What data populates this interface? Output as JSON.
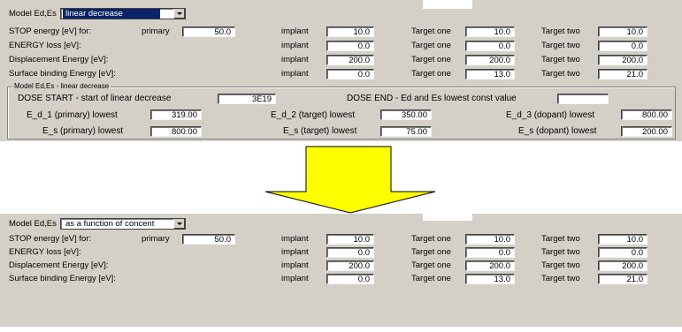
{
  "top": {
    "model_label": "Model Ed,Es",
    "model_value": "linear decrease",
    "rows": [
      {
        "label": "STOP energy [eV] for:",
        "sub_label": "primary",
        "primary_value": "50.0",
        "implant": "10.0",
        "t1": "10.0",
        "t2": "10.0"
      },
      {
        "label": "ENERGY loss [eV]:",
        "implant": "0.0",
        "t1": "0.0",
        "t2": "0.0"
      },
      {
        "label": "Displacement Energy [eV]:",
        "implant": "200.0",
        "t1": "200.0",
        "t2": "200.0"
      },
      {
        "label": "Surface binding Energy [eV]:",
        "implant": "0.0",
        "t1": "13.0",
        "t2": "21.0"
      }
    ],
    "col_implant": "implant",
    "col_t1": "Target one",
    "col_t2": "Target two",
    "group_title": "Model Ed,Es - linear decrease",
    "dose_start_label": "DOSE START - start of linear decrease",
    "dose_start_value": "3E19",
    "dose_end_label": "DOSE END - Ed and Es lowest const value",
    "dose_end_value": "",
    "ed": [
      {
        "label": "E_d_1 (primary) lowest",
        "value": "319.00"
      },
      {
        "label": "E_d_2 (target) lowest",
        "value": "350.00"
      },
      {
        "label": "E_d_3 (dopant) lowest",
        "value": "800.00"
      }
    ],
    "es": [
      {
        "label": "E_s (primary) lowest",
        "value": "800.00"
      },
      {
        "label": "E_s (target) lowest",
        "value": "75.00"
      },
      {
        "label": "E_s (dopant) lowest",
        "value": "200.00"
      }
    ]
  },
  "bottom": {
    "model_label": "Model Ed,Es",
    "model_value": "as a function of concent",
    "rows": [
      {
        "label": "STOP energy [eV] for:",
        "sub_label": "primary",
        "primary_value": "50.0",
        "implant": "10.0",
        "t1": "10.0",
        "t2": "10.0"
      },
      {
        "label": "ENERGY loss [eV]:",
        "implant": "0.0",
        "t1": "0.0",
        "t2": "0.0"
      },
      {
        "label": "Displacement Energy [eV]:",
        "implant": "200.0",
        "t1": "200.0",
        "t2": "200.0"
      },
      {
        "label": "Surface binding Energy [eV]:",
        "implant": "0.0",
        "t1": "13.0",
        "t2": "21.0"
      }
    ],
    "col_implant": "implant",
    "col_t1": "Target one",
    "col_t2": "Target two"
  },
  "colors": {
    "arrow_fill": "#ffff00",
    "panel": "#d4d0c8",
    "selection": "#0a246a"
  },
  "icons": {
    "transition": "down-arrow-icon"
  }
}
